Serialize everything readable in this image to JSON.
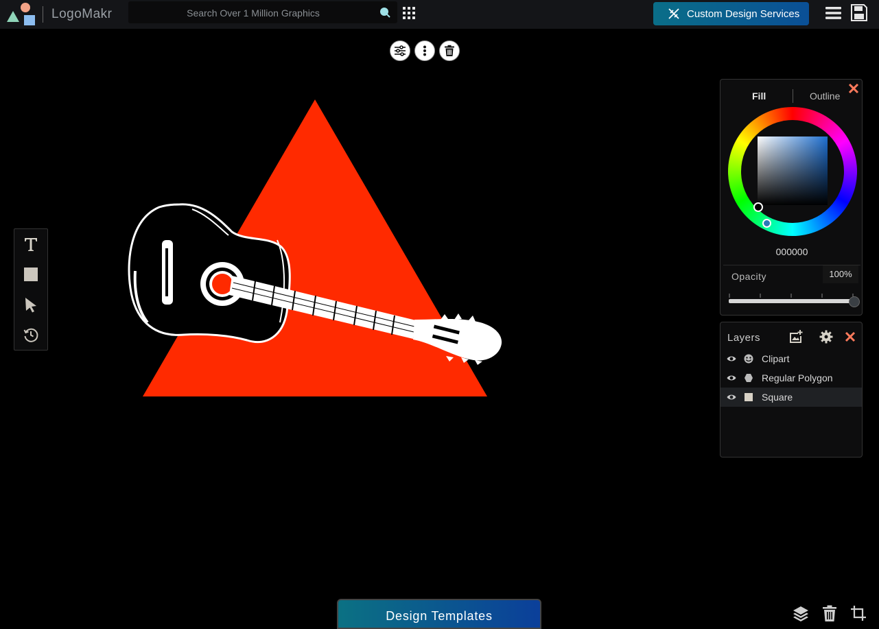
{
  "app": {
    "brand": "LogoMakr"
  },
  "search": {
    "placeholder": "Search Over 1 Million Graphics",
    "icon": "search-icon"
  },
  "header": {
    "grid_icon": "apps-grid-icon",
    "custom_design_label": "Custom Design Services",
    "custom_design_icon": "design-tools-icon",
    "menu_icon": "hamburger-menu-icon",
    "save_icon": "save-disk-icon"
  },
  "selection_toolbar": {
    "items": [
      "adjustments-icon",
      "more-options-icon",
      "delete-icon"
    ]
  },
  "tools": {
    "items": [
      "text-tool-icon",
      "shape-tool-icon",
      "select-pointer-icon",
      "history-icon"
    ]
  },
  "canvas": {
    "triangle_color": "#ff2a00",
    "guitar_color": "#ffffff"
  },
  "color_panel": {
    "tabs": {
      "fill": "Fill",
      "outline": "Outline"
    },
    "active_tab": "Fill",
    "hex_value": "000000",
    "opacity_label": "Opacity",
    "opacity_value": "100%",
    "opacity_fraction": 1.0
  },
  "layers": {
    "title": "Layers",
    "items": [
      {
        "name": "Clipart",
        "type_icon": "clipart-icon",
        "selected": false
      },
      {
        "name": "Regular Polygon",
        "type_icon": "polygon-icon",
        "selected": false
      },
      {
        "name": "Square",
        "type_icon": "square-icon",
        "selected": true
      }
    ]
  },
  "bottom": {
    "templates_label": "Design Templates",
    "actions": [
      "layers-icon",
      "trash-icon",
      "crop-icon"
    ]
  },
  "colors": {
    "accent": "#0a6e88",
    "close": "#ff7a5c"
  }
}
